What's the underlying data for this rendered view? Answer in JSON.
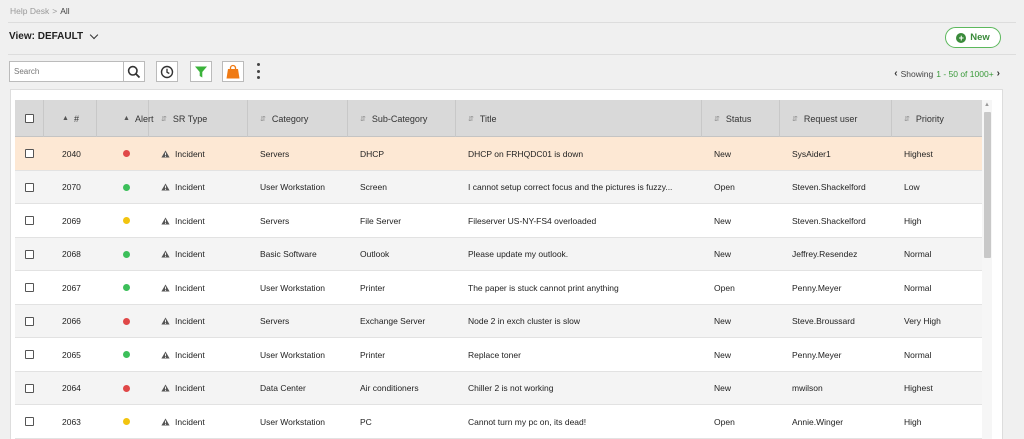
{
  "breadcrumb": {
    "root": "Help Desk",
    "separator": ">",
    "current": "All"
  },
  "view": {
    "label": "View: DEFAULT"
  },
  "new_button": {
    "label": "New"
  },
  "search": {
    "placeholder": "Search",
    "value": ""
  },
  "paging": {
    "prefix": "Showing",
    "range": "1 - 50 of 1000+"
  },
  "colors": {
    "accent_green": "#3a8a3a",
    "selected_row": "#fde8d4",
    "red": "#e04848",
    "green": "#3cbf5a",
    "yellow": "#f2c40f",
    "filter_green": "#3bb33b",
    "bag_orange": "#f07a14"
  },
  "table": {
    "headers": {
      "num": "#",
      "alert": "Alert",
      "type": "SR Type",
      "category": "Category",
      "subcategory": "Sub-Category",
      "title": "Title",
      "status": "Status",
      "user": "Request user",
      "priority": "Priority"
    },
    "rows": [
      {
        "num": "2040",
        "alert": "red",
        "type": "Incident",
        "category": "Servers",
        "subcategory": "DHCP",
        "title": "DHCP on FRHQDC01 is down",
        "status": "New",
        "user": "SysAider1",
        "priority": "Highest"
      },
      {
        "num": "2070",
        "alert": "green",
        "type": "Incident",
        "category": "User Workstation",
        "subcategory": "Screen",
        "title": "I cannot setup correct focus and the pictures is fuzzy...",
        "status": "Open",
        "user": "Steven.Shackelford",
        "priority": "Low"
      },
      {
        "num": "2069",
        "alert": "yellow",
        "type": "Incident",
        "category": "Servers",
        "subcategory": "File Server",
        "title": "Fileserver US-NY-FS4 overloaded",
        "status": "New",
        "user": "Steven.Shackelford",
        "priority": "High"
      },
      {
        "num": "2068",
        "alert": "green",
        "type": "Incident",
        "category": "Basic Software",
        "subcategory": "Outlook",
        "title": "Please update my outlook.",
        "status": "New",
        "user": "Jeffrey.Resendez",
        "priority": "Normal"
      },
      {
        "num": "2067",
        "alert": "green",
        "type": "Incident",
        "category": "User Workstation",
        "subcategory": "Printer",
        "title": "The paper is stuck cannot print anything",
        "status": "Open",
        "user": "Penny.Meyer",
        "priority": "Normal"
      },
      {
        "num": "2066",
        "alert": "red",
        "type": "Incident",
        "category": "Servers",
        "subcategory": "Exchange Server",
        "title": "Node 2 in exch cluster is slow",
        "status": "New",
        "user": "Steve.Broussard",
        "priority": "Very High"
      },
      {
        "num": "2065",
        "alert": "green",
        "type": "Incident",
        "category": "User Workstation",
        "subcategory": "Printer",
        "title": "Replace toner",
        "status": "New",
        "user": "Penny.Meyer",
        "priority": "Normal"
      },
      {
        "num": "2064",
        "alert": "red",
        "type": "Incident",
        "category": "Data Center",
        "subcategory": "Air conditioners",
        "title": "Chiller 2 is not working",
        "status": "New",
        "user": "mwilson",
        "priority": "Highest"
      },
      {
        "num": "2063",
        "alert": "yellow",
        "type": "Incident",
        "category": "User Workstation",
        "subcategory": "PC",
        "title": "Cannot turn my pc on, its dead!",
        "status": "Open",
        "user": "Annie.Winger",
        "priority": "High"
      }
    ]
  }
}
